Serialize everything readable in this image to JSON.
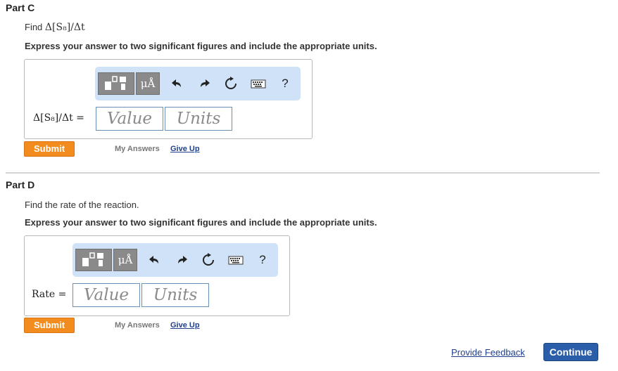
{
  "partC": {
    "title": "Part C",
    "prompt_prefix": "Find",
    "prompt_math": "Δ[S₈]/Δt",
    "instruction": "Express your answer to two significant figures and include the appropriate units.",
    "eq_label": "Δ[S₈]/Δt =",
    "toolbar": {
      "units_symbol": "μÅ",
      "help_symbol": "?"
    },
    "value_placeholder": "Value",
    "units_placeholder": "Units",
    "submit_label": "Submit",
    "my_answers_label": "My Answers",
    "give_up_label": "Give Up"
  },
  "partD": {
    "title": "Part D",
    "prompt": "Find the rate of the reaction.",
    "instruction": "Express your answer to two significant figures and include the appropriate units.",
    "eq_label": "Rate =",
    "toolbar": {
      "units_symbol": "μÅ",
      "help_symbol": "?"
    },
    "value_placeholder": "Value",
    "units_placeholder": "Units",
    "submit_label": "Submit",
    "my_answers_label": "My Answers",
    "give_up_label": "Give Up"
  },
  "footer": {
    "feedback_label": "Provide Feedback",
    "continue_label": "Continue"
  },
  "colors": {
    "submit": "#f28c1e",
    "continue": "#2a5ea8",
    "toolbar_bg": "#cfe2f7",
    "link": "#1f3f8c"
  }
}
